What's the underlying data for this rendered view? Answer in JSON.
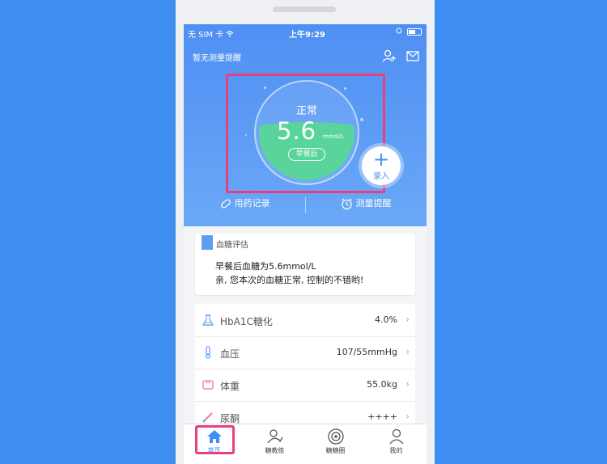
{
  "status_bar": {
    "carrier": "无 SIM 卡",
    "time": "上午9:29"
  },
  "header": {
    "title": "暂无测量提醒",
    "icons": [
      "add-user-icon",
      "mail-icon"
    ]
  },
  "gauge": {
    "status": "正常",
    "value": "5.6",
    "unit": "mmol/L",
    "meal": "早餐后",
    "fill_level": 0.45
  },
  "fab": {
    "plus": "+",
    "label": "录入"
  },
  "quick_actions": [
    {
      "label": "用药记录",
      "icon": "pill-icon"
    },
    {
      "label": "测量提醒",
      "icon": "alarm-clock-icon"
    }
  ],
  "evaluation": {
    "title": "血糖评估",
    "line1": "早餐后血糖为5.6mmol/L",
    "line2": "亲, 您本次的血糖正常, 控制的不错哟!"
  },
  "metrics": [
    {
      "name": "HbA1C糖化",
      "value": "4.0%",
      "icon": "flask-icon"
    },
    {
      "name": "血压",
      "value": "107/55mmHg",
      "icon": "thermometer-icon"
    },
    {
      "name": "体重",
      "value": "55.0kg",
      "icon": "scale-icon"
    },
    {
      "name": "尿酮",
      "value": "++++",
      "icon": "test-strip-icon"
    }
  ],
  "tabs": [
    {
      "label": "首页",
      "icon": "home-icon",
      "active": true
    },
    {
      "label": "糖教练",
      "icon": "coach-icon",
      "active": false
    },
    {
      "label": "糖糖圈",
      "icon": "circle-community-icon",
      "active": false
    },
    {
      "label": "我的",
      "icon": "profile-icon",
      "active": false
    }
  ],
  "colors": {
    "primary": "#4e8ff3",
    "water": "#59d49a",
    "highlight": "#e8407f",
    "background": "#3f8ef2"
  }
}
